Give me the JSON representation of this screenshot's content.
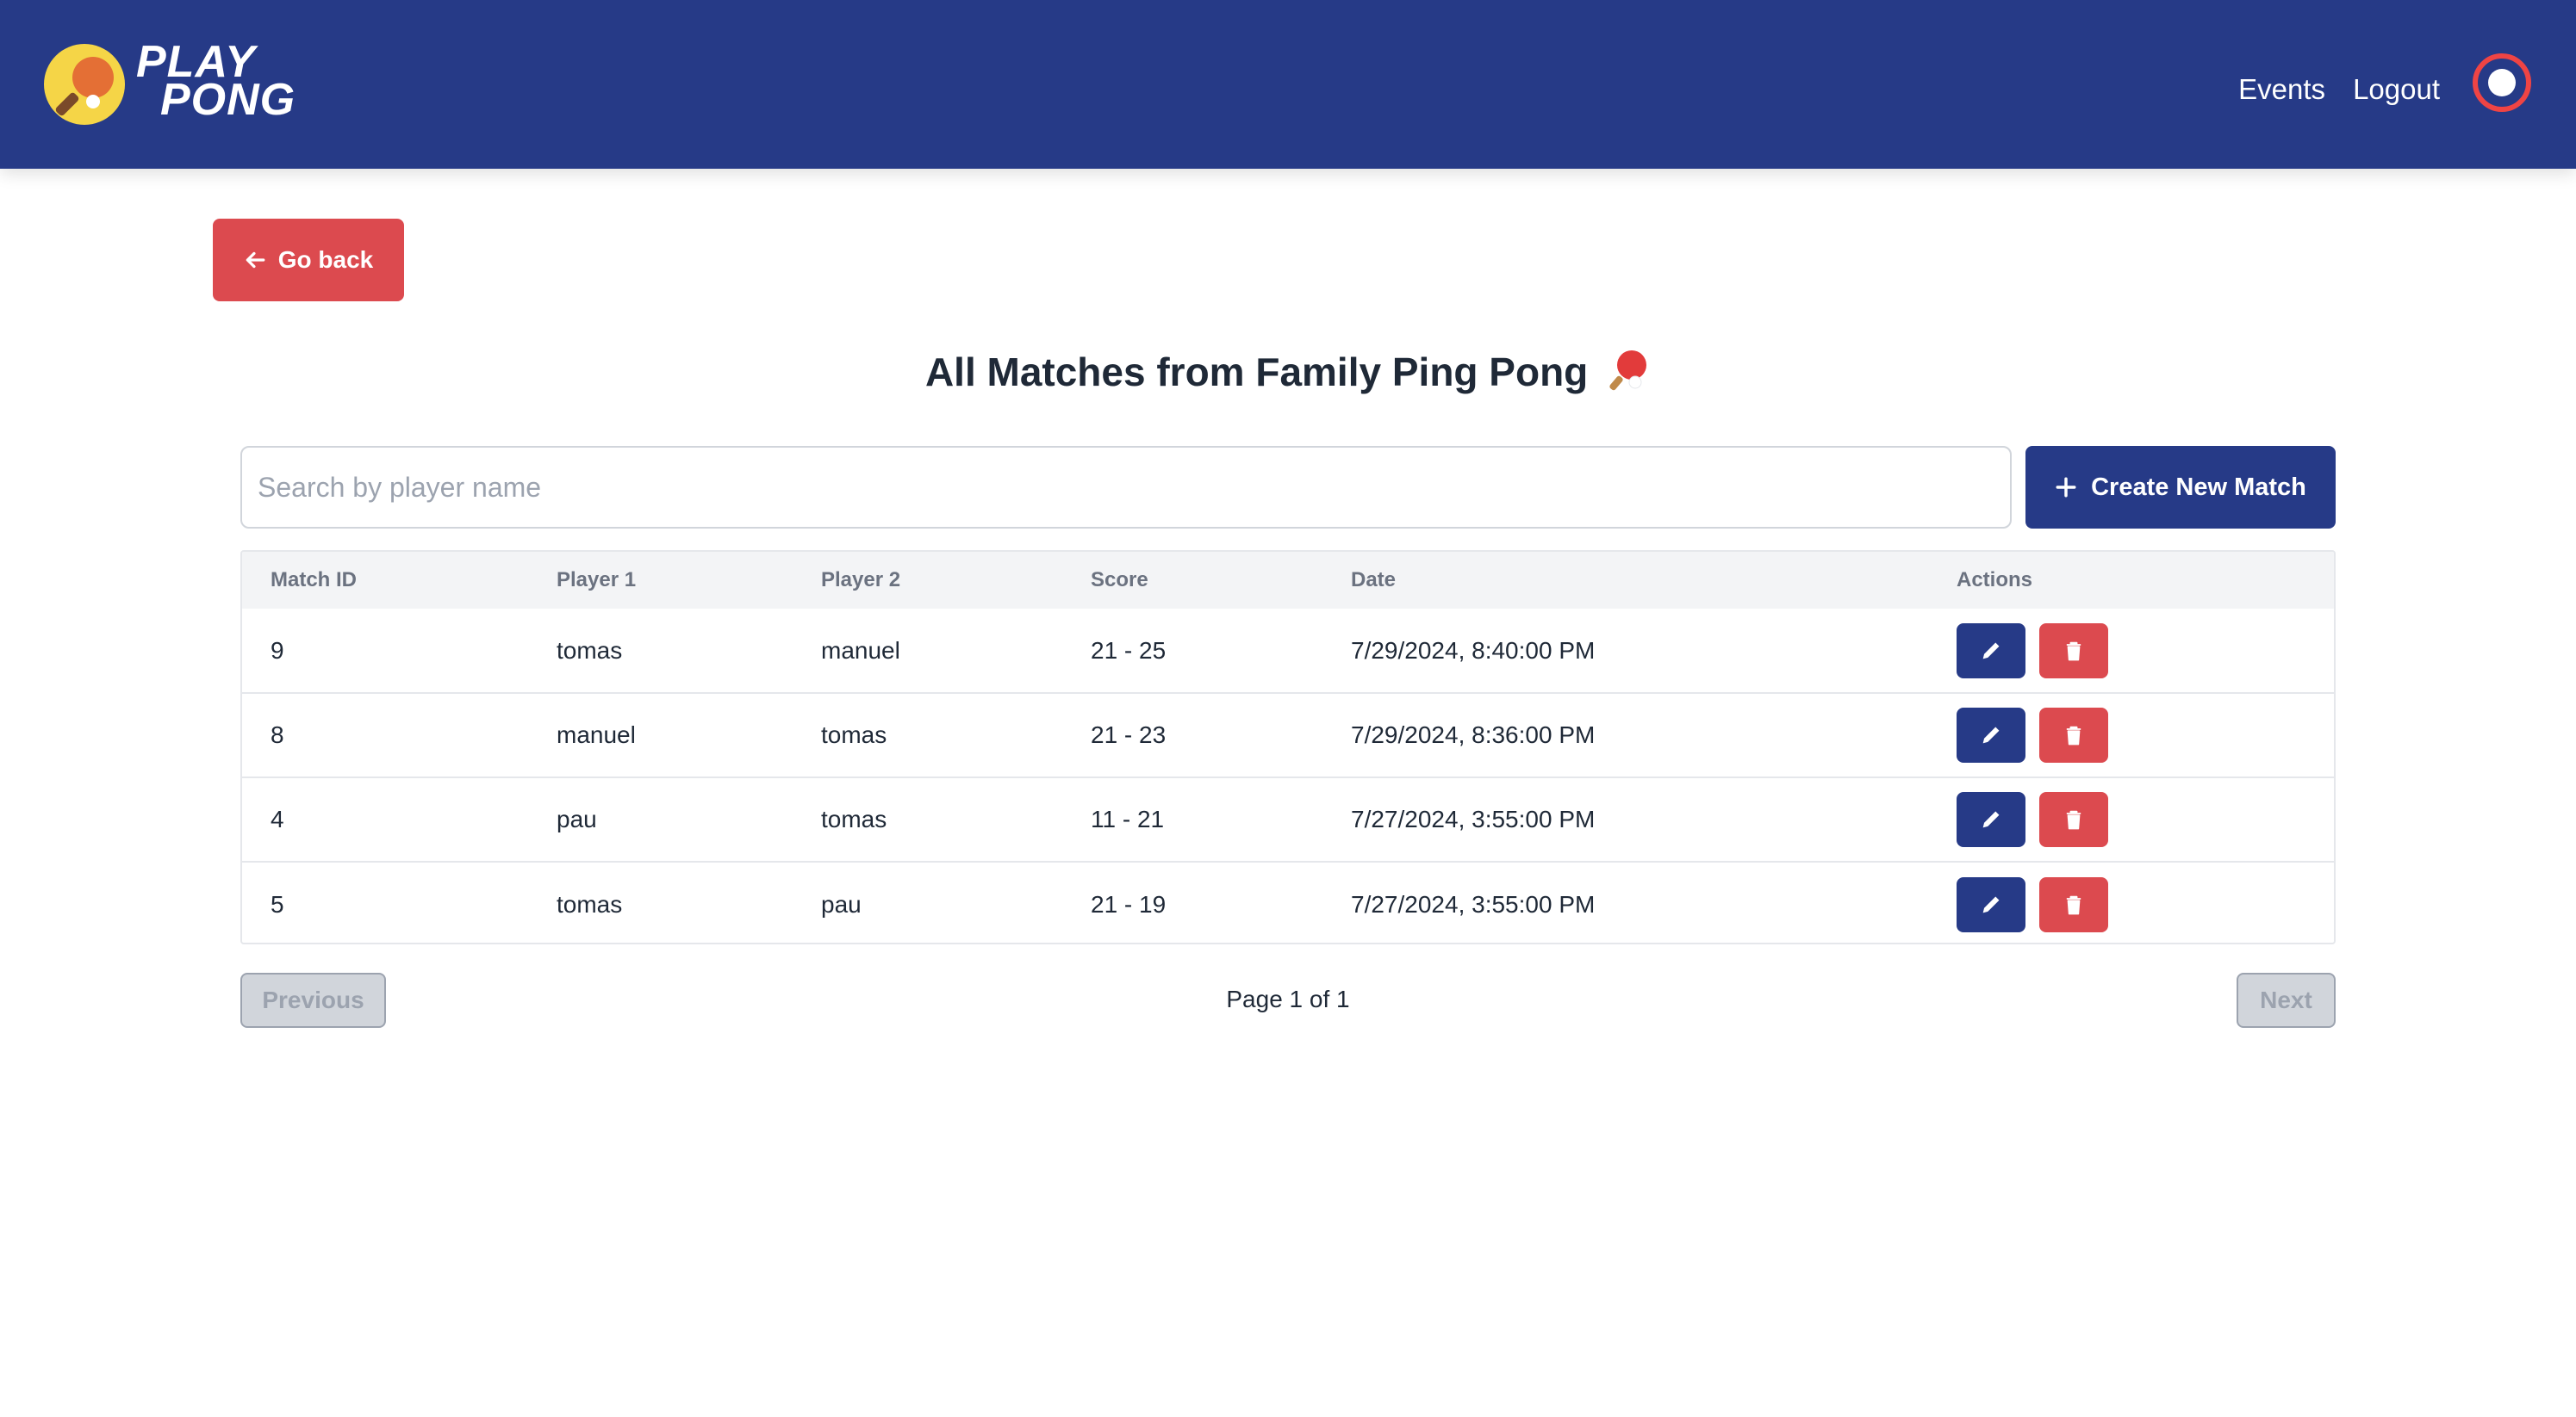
{
  "header": {
    "brand_line1": "PLAY",
    "brand_line2": "PONG",
    "nav": {
      "events": "Events",
      "logout": "Logout"
    },
    "colors": {
      "background": "#263a87",
      "toggle_ring": "#ef4444"
    }
  },
  "go_back": {
    "label": "Go back",
    "icon": "arrow-left-icon",
    "color": "#dc4a4f"
  },
  "title": "All Matches from Family Ping Pong",
  "title_icon": "ping-pong-paddle-icon",
  "search": {
    "placeholder": "Search by player name",
    "value": ""
  },
  "create_button": {
    "label": "Create New Match",
    "icon": "plus-icon",
    "color": "#263a87"
  },
  "table": {
    "columns": [
      "Match ID",
      "Player 1",
      "Player 2",
      "Score",
      "Date",
      "Actions"
    ],
    "rows": [
      {
        "id": "9",
        "player1": "tomas",
        "player2": "manuel",
        "score": "21 - 25",
        "date": "7/29/2024, 8:40:00 PM"
      },
      {
        "id": "8",
        "player1": "manuel",
        "player2": "tomas",
        "score": "21 - 23",
        "date": "7/29/2024, 8:36:00 PM"
      },
      {
        "id": "4",
        "player1": "pau",
        "player2": "tomas",
        "score": "11 - 21",
        "date": "7/27/2024, 3:55:00 PM"
      },
      {
        "id": "5",
        "player1": "tomas",
        "player2": "pau",
        "score": "21 - 19",
        "date": "7/27/2024, 3:55:00 PM"
      }
    ],
    "action_icons": {
      "edit": "pencil-icon",
      "delete": "trash-icon"
    }
  },
  "pagination": {
    "previous_label": "Previous",
    "next_label": "Next",
    "page_info": "Page 1 of 1"
  }
}
